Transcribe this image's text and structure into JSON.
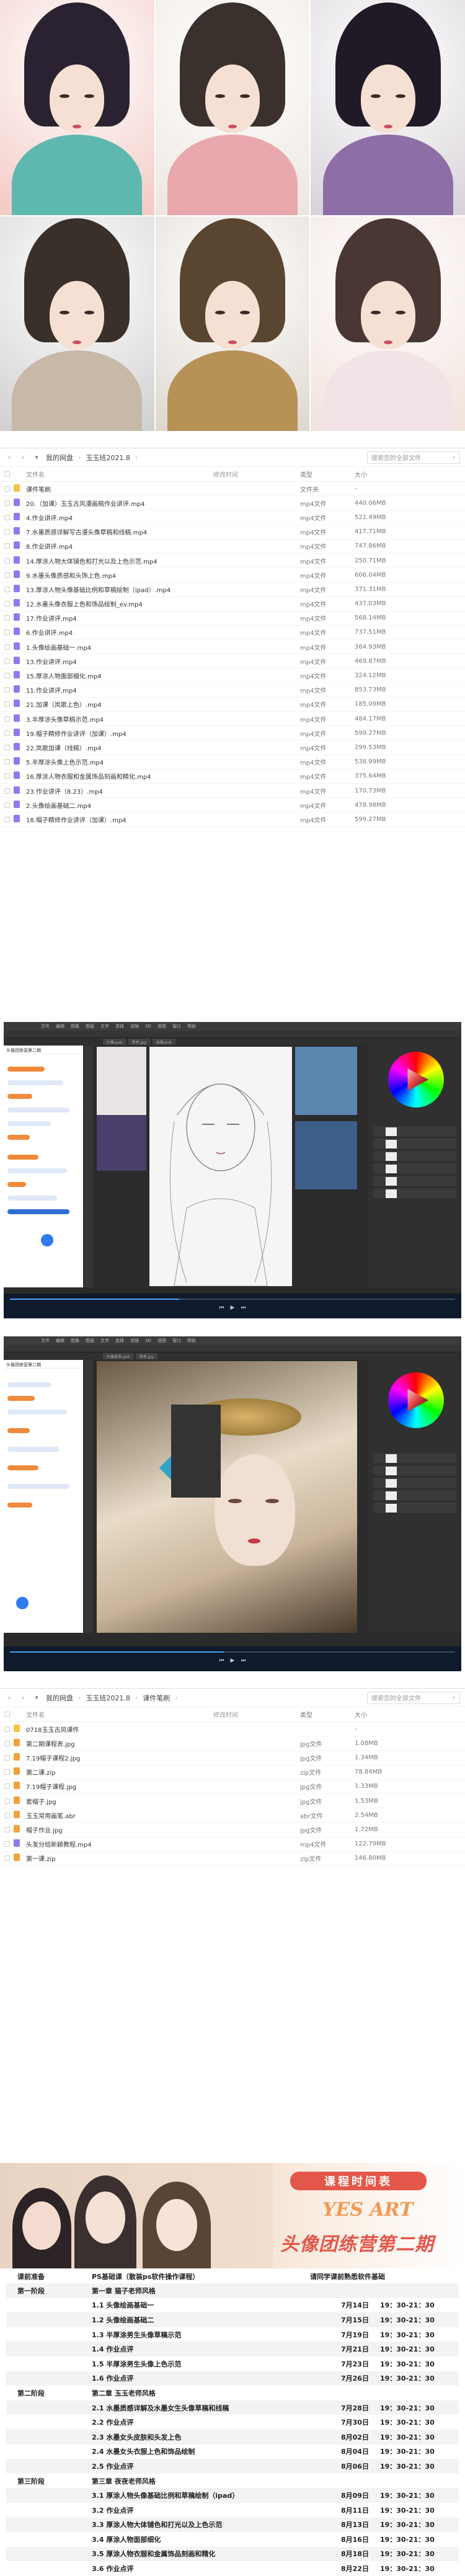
{
  "colors": {
    "folder": "#f5c342",
    "video": "#8a7cf0",
    "image": "#f2a23c",
    "zip": "#f2a23c",
    "banner_red": "#e3574b",
    "banner_orange": "#f09a55"
  },
  "gallery": {
    "items": [
      {
        "name": "portrait-1",
        "bg": "#f3c9c4",
        "hair": "#2a2230",
        "robe": "#5fb8b0"
      },
      {
        "name": "portrait-2",
        "bg": "#ece6df",
        "hair": "#3a302c",
        "robe": "#e9a8ae"
      },
      {
        "name": "portrait-3",
        "bg": "#d7d2d8",
        "hair": "#1f1a26",
        "robe": "#8d6ea6"
      },
      {
        "name": "portrait-4",
        "bg": "#cfcfcf",
        "hair": "#3a302a",
        "robe": "#c7b8a8"
      },
      {
        "name": "portrait-5",
        "bg": "#ded7cf",
        "hair": "#5a4630",
        "robe": "#b79257"
      },
      {
        "name": "portrait-6",
        "bg": "#f1e2dc",
        "hair": "#4a3632",
        "robe": "#f2e4e6"
      }
    ]
  },
  "browser1": {
    "breadcrumb": [
      "我的网盘",
      "玉玉班2021.8"
    ],
    "search_placeholder": "搜索您的全部文件",
    "headers": {
      "name": "文件名",
      "date": "修改时间",
      "type": "类型",
      "size": "大小"
    },
    "rows": [
      {
        "icon": "folder",
        "name": "课件笔刷",
        "type": "文件夹",
        "size": "-"
      },
      {
        "icon": "video",
        "name": "20.（加课）玉玉古风漫画稿作业讲评.mp4",
        "type": "mp4文件",
        "size": "440.06MB"
      },
      {
        "icon": "video",
        "name": "4.作业讲评.mp4",
        "type": "mp4文件",
        "size": "521.49MB"
      },
      {
        "icon": "video",
        "name": "7.水墨质感详解写古漫头像草稿和线稿.mp4",
        "type": "mp4文件",
        "size": "417.71MB"
      },
      {
        "icon": "video",
        "name": "8.作业讲评.mp4",
        "type": "mp4文件",
        "size": "747.86MB"
      },
      {
        "icon": "video",
        "name": "14.厚涂人物大体铺色和打光以及上色示范.mp4",
        "type": "mp4文件",
        "size": "250.71MB"
      },
      {
        "icon": "video",
        "name": "9.水墨头像质感和头饰上色.mp4",
        "type": "mp4文件",
        "size": "606.04MB"
      },
      {
        "icon": "video",
        "name": "13.厚涂人物头像基础比例和草稿绘制（ipad）.mp4",
        "type": "mp4文件",
        "size": "371.31MB"
      },
      {
        "icon": "video",
        "name": "12.水墨头像衣服上色和饰品绘制_ev.mp4",
        "type": "mp4文件",
        "size": "437.03MB"
      },
      {
        "icon": "video",
        "name": "17.作业讲评.mp4",
        "type": "mp4文件",
        "size": "568.14MB"
      },
      {
        "icon": "video",
        "name": "6.作业讲评.mp4",
        "type": "mp4文件",
        "size": "737.51MB"
      },
      {
        "icon": "video",
        "name": "1.头像绘画基础一.mp4",
        "type": "mp4文件",
        "size": "364.93MB"
      },
      {
        "icon": "video",
        "name": "13.作业讲评.mp4",
        "type": "mp4文件",
        "size": "469.87MB"
      },
      {
        "icon": "video",
        "name": "15.厚涂人物面部细化.mp4",
        "type": "mp4文件",
        "size": "324.12MB"
      },
      {
        "icon": "video",
        "name": "11.作业讲评.mp4",
        "type": "mp4文件",
        "size": "853.73MB"
      },
      {
        "icon": "video",
        "name": "21.加课（岚歌上色）.mp4",
        "type": "mp4文件",
        "size": "185.09MB"
      },
      {
        "icon": "video",
        "name": "3.半厚涂头像草稿示范.mp4",
        "type": "mp4文件",
        "size": "484.17MB"
      },
      {
        "icon": "video",
        "name": "19.帽子精修作业讲评（加课）.mp4",
        "type": "mp4文件",
        "size": "599.27MB"
      },
      {
        "icon": "video",
        "name": "22.岚歌加课（线稿）.mp4",
        "type": "mp4文件",
        "size": "299.53MB"
      },
      {
        "icon": "video",
        "name": "5.半厚涂头像上色示范.mp4",
        "type": "mp4文件",
        "size": "538.99MB"
      },
      {
        "icon": "video",
        "name": "16.厚涂人物衣服和金属饰品刻画和精化.mp4",
        "type": "mp4文件",
        "size": "375.64MB"
      },
      {
        "icon": "video",
        "name": "23.作业讲评（8.23）.mp4",
        "type": "mp4文件",
        "size": "170.73MB"
      },
      {
        "icon": "video",
        "name": "2.头像绘画基础二.mp4",
        "type": "mp4文件",
        "size": "478.98MB"
      },
      {
        "icon": "video",
        "name": "18.帽子精修作业讲评（加课）.mp4",
        "type": "mp4文件",
        "size": "599.27MB"
      }
    ]
  },
  "ps1": {
    "chat_title": "头像团练营第二期",
    "progress": 0.38
  },
  "ps2": {
    "chat_title": "头像团练营第二期",
    "progress": 0.48
  },
  "browser2": {
    "breadcrumb": [
      "我的网盘",
      "玉玉班2021.8",
      "课件笔刷"
    ],
    "search_placeholder": "搜索您的全部文件",
    "headers": {
      "name": "文件名",
      "date": "修改时间",
      "type": "类型",
      "size": "大小"
    },
    "rows": [
      {
        "icon": "folder",
        "name": "0718玉玉古风课件",
        "type": "",
        "size": "-"
      },
      {
        "icon": "image",
        "name": "第二期课程表.jpg",
        "type": "jpg文件",
        "size": "1.08MB"
      },
      {
        "icon": "image",
        "name": "7.19帽子课程2.jpg",
        "type": "jpg文件",
        "size": "1.34MB"
      },
      {
        "icon": "zip",
        "name": "第二课.zip",
        "type": "zip文件",
        "size": "78.84MB"
      },
      {
        "icon": "image",
        "name": "7.19帽子课程.jpg",
        "type": "jpg文件",
        "size": "1.33MB"
      },
      {
        "icon": "image",
        "name": "套帽子.jpg",
        "type": "jpg文件",
        "size": "1.53MB"
      },
      {
        "icon": "image",
        "name": "玉玉常用画笔.abr",
        "type": "abr文件",
        "size": "2.54MB"
      },
      {
        "icon": "image",
        "name": "帽子作业.jpg",
        "type": "jpg文件",
        "size": "1.72MB"
      },
      {
        "icon": "video",
        "name": "头发分组新颖教程.mp4",
        "type": "mp4文件",
        "size": "122.79MB"
      },
      {
        "icon": "zip",
        "name": "第一课.zip",
        "type": "zip文件",
        "size": "146.80MB"
      }
    ]
  },
  "banner": {
    "schedule_title": "课程时间表",
    "yes_art": "YES ART",
    "camp_title": "头像团练营第二期"
  },
  "schedule": {
    "headers": [
      "课前准备",
      "PS基础课（散装ps软件操作课程）",
      "",
      "请同学课前熟悉软件基础"
    ],
    "rows": [
      {
        "stage": "第一阶段",
        "topic": "第一章 猫子老师风格",
        "date": "",
        "time": "",
        "bold": true
      },
      {
        "stage": "",
        "topic": "1.1  头像绘画基础一",
        "date": "7月14日",
        "time": "19：30-21：30"
      },
      {
        "stage": "",
        "topic": "1.2  头像绘画基础二",
        "date": "7月15日",
        "time": "19：30-21：30"
      },
      {
        "stage": "",
        "topic": "1.3  半厚涂男生头像草稿示范",
        "date": "7月19日",
        "time": "19：30-21：30"
      },
      {
        "stage": "",
        "topic": "1.4  作业点评",
        "date": "7月21日",
        "time": "19：30-21：30"
      },
      {
        "stage": "",
        "topic": "1.5  半厚涂男生头像上色示范",
        "date": "7月23日",
        "time": "19：30-21：30"
      },
      {
        "stage": "",
        "topic": "1.6  作业点评",
        "date": "7月26日",
        "time": "19：30-21：30"
      },
      {
        "stage": "第二阶段",
        "topic": "第二章 玉玉老师风格",
        "date": "",
        "time": ""
      },
      {
        "stage": "",
        "topic": "2.1  水墨质感详解及水墨女生头像草稿和线稿",
        "date": "7月28日",
        "time": "19：30-21：30"
      },
      {
        "stage": "",
        "topic": "2.2  作业点评",
        "date": "7月30日",
        "time": "19：30-21：30"
      },
      {
        "stage": "",
        "topic": "2.3  水墨女头皮肤和头发上色",
        "date": "8月02日",
        "time": "19：30-21：30"
      },
      {
        "stage": "",
        "topic": "2.4  水墨女头衣服上色和饰品绘制",
        "date": "8月04日",
        "time": "19：30-21：30"
      },
      {
        "stage": "",
        "topic": "2.5  作业点评",
        "date": "8月06日",
        "time": "19：30-21：30"
      },
      {
        "stage": "第三阶段",
        "topic": "第三章 夜夜老师风格",
        "date": "",
        "time": ""
      },
      {
        "stage": "",
        "topic": "3.1  厚涂人物头像基础比例和草稿绘制（ipad）",
        "date": "8月09日",
        "time": "19：30-21：30"
      },
      {
        "stage": "",
        "topic": "3.2  作业点评",
        "date": "8月11日",
        "time": "19：30-21：30"
      },
      {
        "stage": "",
        "topic": "3.3  厚涂人物大体铺色和打光以及上色示范",
        "date": "8月13日",
        "time": "19：30-21：30"
      },
      {
        "stage": "",
        "topic": "3.4  厚涂人物面部细化",
        "date": "8月16日",
        "time": "19：30-21：30"
      },
      {
        "stage": "",
        "topic": "3.5  厚涂人物衣服和金属饰品刻画和精化",
        "date": "8月18日",
        "time": "19：30-21：30"
      },
      {
        "stage": "",
        "topic": "3.6  作业点评",
        "date": "8月22日",
        "time": "19：30-21：30"
      }
    ]
  }
}
